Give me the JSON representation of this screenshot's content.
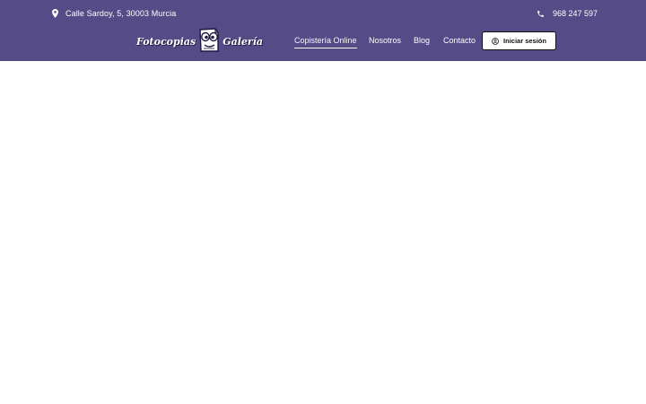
{
  "header": {
    "address": "Calle Sardoy, 5, 30003 Murcia",
    "phone": "968 247 597",
    "background_color": "#554b86"
  },
  "logo": {
    "word_left": "Fotocopias",
    "word_right": "Galería"
  },
  "nav": {
    "items": [
      {
        "label": "Copistería Online",
        "active": true
      },
      {
        "label": "Nosotros",
        "active": false
      },
      {
        "label": "Blog",
        "active": false
      },
      {
        "label": "Contacto",
        "active": false
      }
    ]
  },
  "login": {
    "label": "Iniciar sesión",
    "icon": "user-circle-icon"
  },
  "icons": {
    "address": "map-pin-icon",
    "phone": "phone-icon"
  }
}
